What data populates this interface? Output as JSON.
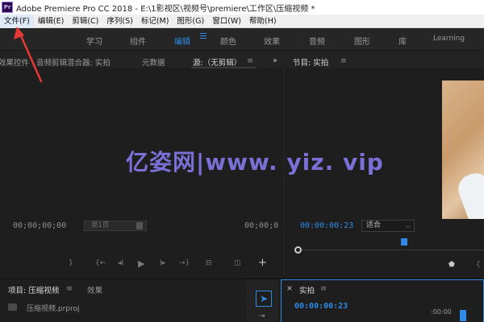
{
  "window": {
    "app_icon": "Pr",
    "title": "Adobe Premiere Pro CC 2018 - E:\\1影视区\\视频号\\premiere\\工作区\\压缩视频 *"
  },
  "menu": [
    {
      "label": "文件(F)"
    },
    {
      "label": "编辑(E)"
    },
    {
      "label": "剪辑(C)"
    },
    {
      "label": "序列(S)"
    },
    {
      "label": "标记(M)"
    },
    {
      "label": "图形(G)"
    },
    {
      "label": "窗口(W)"
    },
    {
      "label": "帮助(H)"
    }
  ],
  "workspaces": [
    "学习",
    "组件",
    "编辑",
    "颜色",
    "效果",
    "音频",
    "图形",
    "库",
    "Learning"
  ],
  "source_panel": {
    "tabs": [
      "效果控件",
      "音频剪辑混合器: 实拍",
      "元数据",
      "源:（无剪辑）"
    ],
    "overflow": "»",
    "timecode_left": "00;00;00;00",
    "page_select": "第1页",
    "timecode_right": "00;00;0"
  },
  "program_panel": {
    "title": "节目: 实拍",
    "timecode": "00:00:00:23",
    "fit": "适合",
    "fit_arrow": "⌵"
  },
  "project_panel": {
    "tabs": [
      "项目: 压缩视频",
      "效果"
    ],
    "file": "压缩视频.prproj"
  },
  "timeline_panel": {
    "title": "实拍",
    "timecode": "00:00:00:23",
    "ruler": ":00:00"
  },
  "watermark": "亿姿网|www. yiz. vip",
  "icons": {
    "selection": "selection-tool-icon",
    "close": "close-icon",
    "menu": "panel-menu-icon"
  },
  "colors": {
    "accent": "#2e8ae6",
    "annotation_arrow": "#e53935"
  }
}
